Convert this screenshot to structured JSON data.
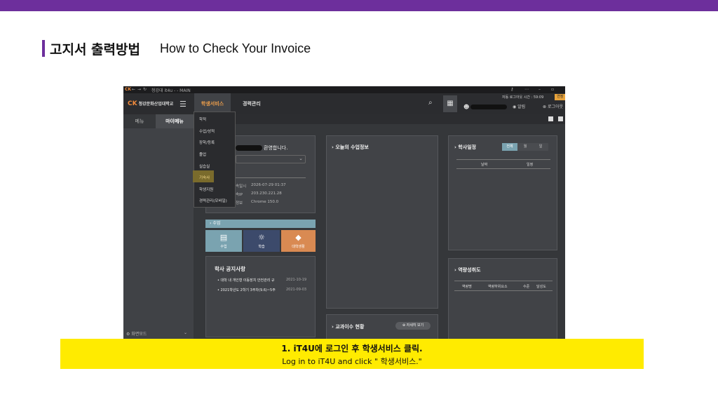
{
  "slide": {
    "title_ko": "고지서 출력방법",
    "title_en": "How to Check Your Invoice",
    "caption_line1": "1. iT4U에 로그인 후 학생서비스 클릭.",
    "caption_line2": "Log in to iT4U and click \" 학생서비스.\""
  },
  "colors": {
    "accent": "#6d2f9c",
    "highlight": "#ffeb00",
    "menu_active": "#f0a04b"
  },
  "browser": {
    "window_title": "청강대 it4u - - MAIN"
  },
  "app": {
    "logo_text": "청강문화산업대학교",
    "menu_tab_student": "학생서비스",
    "menu_tab_career": "경력관리",
    "auto_logout_label": "자동 로그아웃 시간 : 59:09",
    "extend_label": "연장",
    "alarm_label": "알림",
    "logout_label": "로그아웃",
    "side_tab_menu": "메뉴",
    "side_tab_mymenu": "마이메뉴",
    "screen_mode": "화면모드"
  },
  "dropdown": {
    "items": [
      "학적",
      "수업/성적",
      "장학/등록",
      "졸업",
      "실습실",
      "기숙사",
      "학생지원",
      "경력관리(모바일)"
    ]
  },
  "profile": {
    "welcome": "환영합니다.",
    "rows": [
      {
        "label": "속일시",
        "value": "2026-07-29 01:37"
      },
      {
        "label": "속IP",
        "value": "203.230.221.28"
      },
      {
        "label": "정보",
        "value": "Chrome 150.0"
      }
    ]
  },
  "class_section": {
    "header": "수업",
    "tiles": [
      {
        "label": "수업",
        "icon": "book-icon",
        "color": "#7aa3b0"
      },
      {
        "label": "학습",
        "icon": "lightbulb-icon",
        "color": "#3c4a6b"
      },
      {
        "label": "대학생활",
        "icon": "graduation-cap-icon",
        "color": "#d98a52"
      }
    ]
  },
  "notices": {
    "title": "학사 공지사항",
    "items": [
      {
        "text": "대학 내 개인형 이동장치 안전관리 규",
        "date": "2021-10-19"
      },
      {
        "text": "2021학년도 2학기 3주차(9.6)~5주",
        "date": "2021-09-03"
      }
    ]
  },
  "today_class": {
    "title": "오늘의 수업정보"
  },
  "completion": {
    "title": "교과이수 현황",
    "detail_button": "자세히 보기"
  },
  "calendar": {
    "title": "학사일정",
    "segments": [
      "전체",
      "월",
      "일"
    ],
    "columns": [
      "날짜",
      "일정"
    ]
  },
  "competency": {
    "title": "역량성취도",
    "columns": [
      "역량명",
      "역량하위요소",
      "수준",
      "달성도"
    ]
  }
}
